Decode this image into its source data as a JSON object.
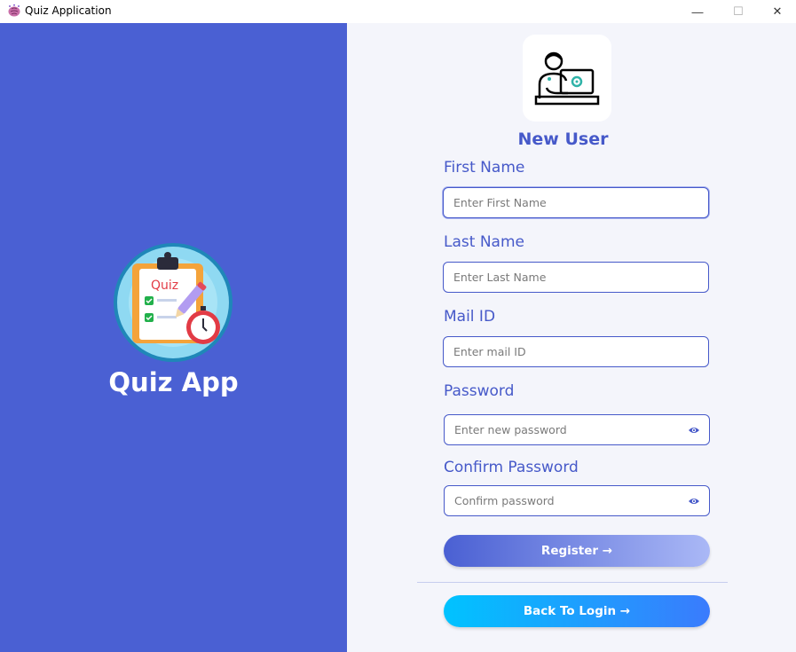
{
  "window": {
    "title": "Quiz Application",
    "minimize_glyph": "—",
    "maximize_glyph": "☐",
    "close_glyph": "✕"
  },
  "left_panel": {
    "logo_text": "Quiz",
    "brand": "Quiz App"
  },
  "form": {
    "title": "New User",
    "fields": [
      {
        "label": "First Name",
        "placeholder": "Enter First Name",
        "value": ""
      },
      {
        "label": "Last Name",
        "placeholder": "Enter Last Name",
        "value": ""
      },
      {
        "label": "Mail ID",
        "placeholder": "Enter mail ID",
        "value": ""
      },
      {
        "label": "Password",
        "placeholder": "Enter new password",
        "value": ""
      },
      {
        "label": "Confirm Password",
        "placeholder": "Confirm password",
        "value": ""
      }
    ],
    "register_label": "Register →",
    "back_label": "Back To Login →"
  },
  "colors": {
    "brand_blue": "#4a60d3",
    "label_blue": "#4659c9",
    "panel_bg": "#f4f5fb",
    "back_button_start": "#00c3ff",
    "back_button_end": "#3a7bfd"
  },
  "icons": {
    "app": "brain-icon",
    "avatar": "user-laptop-icon",
    "logo": "quiz-clipboard-icon",
    "password_toggle": "eye-icon"
  }
}
